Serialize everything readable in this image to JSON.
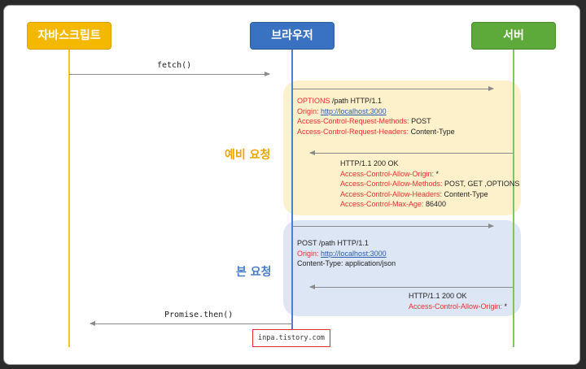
{
  "actors": {
    "javascript": "자바스크립트",
    "browser": "브라우저",
    "server": "서버"
  },
  "messages": {
    "fetch": "fetch()",
    "promise": "Promise.then()"
  },
  "preflight": {
    "section_label": "예비 요청",
    "request": {
      "line": "OPTIONS",
      "line_rest": " /path HTTP/1.1",
      "origin_key": "Origin:",
      "origin_val": "http://localhost:3000",
      "method_key": "Access-Control-Request-Methods:",
      "method_val": " POST",
      "headers_key": "Access-Control-Request-Headers:",
      "headers_val": " Content-Type"
    },
    "response": {
      "status": "HTTP/1.1 200 OK",
      "allow_origin_key": "Access-Control-Allow-Origin:",
      "allow_origin_val": " *",
      "allow_methods_key": "Access-Control-Allow-Methods:",
      "allow_methods_val": " POST, GET ,OPTIONS",
      "allow_headers_key": "Access-Control-Allow-Headers:",
      "allow_headers_val": " Content-Type",
      "max_age_key": "Access-Control-Max-Age:",
      "max_age_val": " 86400"
    }
  },
  "main": {
    "section_label": "본 요청",
    "request": {
      "line": "POST /path HTTP/1.1",
      "origin_key": "Origin:",
      "origin_val": "http://localhost:3000",
      "content_type": "Content-Type: application/json"
    },
    "response": {
      "status": "HTTP/1.1 200 OK",
      "allow_origin_key": "Access-Control-Allow-Origin:",
      "allow_origin_val": " *"
    }
  },
  "watermark": "inpa.tistory.com",
  "colors": {
    "javascript": "#f5b800",
    "browser": "#3a72c2",
    "server": "#5da93a",
    "header_key": "#e83030",
    "link": "#2a5db0"
  }
}
